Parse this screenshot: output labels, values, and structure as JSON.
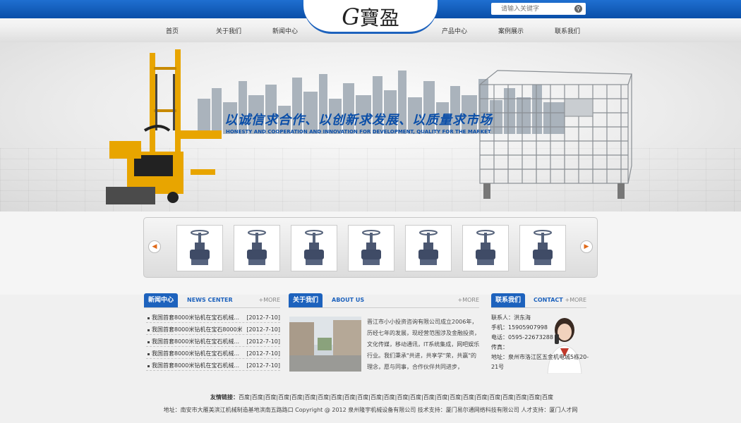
{
  "brand": {
    "logo_latin": "G",
    "logo_cn": "寶盈"
  },
  "search": {
    "placeholder": "请输入关键字",
    "button_icon": "search-icon"
  },
  "nav": [
    "首页",
    "关于我们",
    "新闻中心",
    "产品中心",
    "案例展示",
    "联系我们"
  ],
  "banner": {
    "slogan_cn": "以诚信求合作、以创新求发展、以质量求市场",
    "slogan_en": "HONESTY AND COOPERATION AND INNOVATION FOR DEVELOPMENT, QUALITY FOR THE MARKET"
  },
  "products": {
    "prev_icon": "arrow-left-icon",
    "next_icon": "arrow-right-icon",
    "items": [
      "valve",
      "valve",
      "valve",
      "valve",
      "valve",
      "valve",
      "valve"
    ]
  },
  "news": {
    "title_cn": "新闻中心",
    "title_en": "NEWS CENTER",
    "more": "+MORE",
    "items": [
      {
        "title": "我国首套8000米钻机在宝石机械...",
        "date": "[2012-7-10]"
      },
      {
        "title": "我国首套8000米钻机在宝石8000米钻机在",
        "date": "[2012-7-10]"
      },
      {
        "title": "我国首套8000米钻机在宝石机械...",
        "date": "[2012-7-10]"
      },
      {
        "title": "我国首套8000米钻机在宝石机械...",
        "date": "[2012-7-10]"
      },
      {
        "title": "我国首套8000米钻机在宝石机械...",
        "date": "[2012-7-10]"
      }
    ]
  },
  "about": {
    "title_cn": "关于我们",
    "title_en": "ABOUT US",
    "more": "+MORE",
    "text": "晋江市小小投资咨询有限公司成立2006年，历经七年的发展，现经营范围涉及金融投资，文化传媒，移动通讯，IT系统集成，网吧娱乐行业。我们秉承\"共进，共享学\"荣，共赢\"的理念，愿与同事，合作伙伴共同进步，"
  },
  "contact": {
    "title_cn": "联系我们",
    "title_en": "CONTACT",
    "more": "+MORE",
    "lines": [
      "联系人：洪东海",
      "手机：15905907998",
      "电话：0595-22673288",
      "传真：",
      "地址：泉州市洛江区五金机电城5栋20-",
      "21号"
    ]
  },
  "links": {
    "label": "友情链接：",
    "items": "百度|百度|百度|百度|百度|百度|百度|百度|百度|百度|百度|百度|百度|百度|百度|百度|百度|百度|百度|百度|百度|百度|百度|百度"
  },
  "footer": "地址：南安市大雁美滨江机械制造基地滨南五路路口 Copyright @ 2012 泉州隆宇机械设备有限公司 技术支持：厦门易尔通网络科技有限公司 人才支持：厦门人才网",
  "colors": {
    "primary": "#1d62bd",
    "topbar": "#0a4fa8",
    "accent": "#e06a1a"
  }
}
